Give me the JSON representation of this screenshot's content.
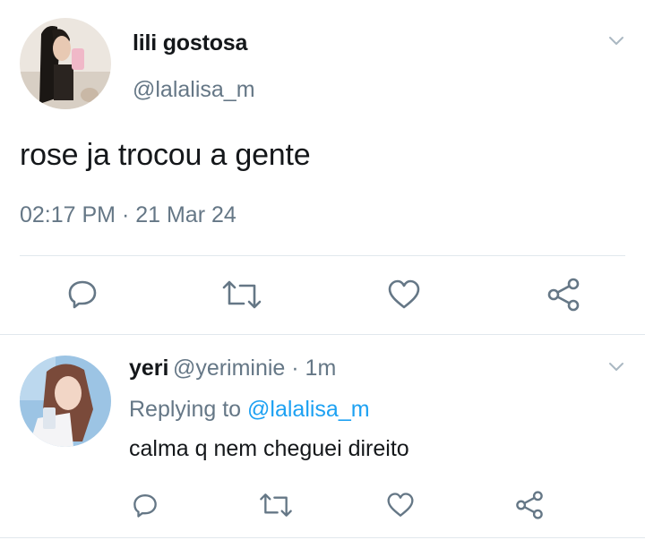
{
  "main_tweet": {
    "display_name": "lili gostosa",
    "handle": "@lalalisa_m",
    "text": "rose ja trocou a gente",
    "timestamp": "02:17 PM · 21 Mar 24",
    "actions": [
      "reply-icon",
      "retweet-icon",
      "like-icon",
      "share-icon"
    ]
  },
  "reply_tweet": {
    "display_name": "yeri",
    "handle_time": "@yeriminie · 1m",
    "replying_prefix": "Replying to",
    "replying_to": "@lalalisa_m",
    "text": "calma q nem cheguei direito",
    "actions": [
      "reply-icon",
      "retweet-icon",
      "like-icon",
      "share-icon"
    ]
  },
  "colors": {
    "icon_gray": "#657786",
    "link_blue": "#1da1f2",
    "divider": "#e1e8ed"
  }
}
